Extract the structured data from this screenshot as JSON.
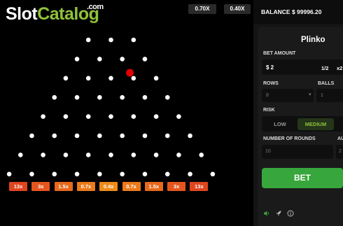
{
  "logo": {
    "slot": "Slot",
    "catalog": "Catalog",
    "com": ".com"
  },
  "history": [
    "0.70X",
    "0.40X"
  ],
  "multipliers": [
    "13x",
    "3x",
    "1.5x",
    "0.7x",
    "0.4x",
    "0.7x",
    "1.5x",
    "3x",
    "13x"
  ],
  "multiplier_colors": [
    "#e0451f",
    "#e5561e",
    "#e8681d",
    "#eb7a1b",
    "#ee8c19",
    "#eb7a1b",
    "#e8681d",
    "#e5561e",
    "#e0451f"
  ],
  "board": {
    "rows": 8,
    "peg_color": "#ffffff",
    "ball_color": "#e00000"
  },
  "panel": {
    "balance_label": "BALANCE",
    "balance_value": "$ 99996.20",
    "title": "Plinko",
    "bet_amount_label": "BET AMOUNT",
    "bet_amount": "$ 2",
    "half_label": "1/2",
    "double_label": "x2",
    "rows_label": "ROWS",
    "rows_value": "8",
    "balls_label": "BALLS",
    "balls_value": "1",
    "risk_label": "RISK",
    "risk_low": "LOW",
    "risk_medium": "MEDIUM",
    "rounds_label": "NUMBER OF ROUNDS",
    "rounds_value": "10",
    "auto_label": "AU",
    "auto_value": "2",
    "bet_button": "BET"
  },
  "accent_color": "#8fc23a",
  "bet_color": "#37a63c",
  "icons": [
    "speaker-icon",
    "rocket-icon",
    "info-icon"
  ]
}
